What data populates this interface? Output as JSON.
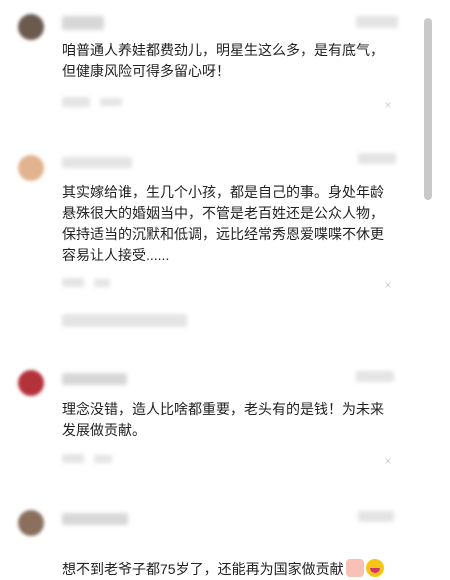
{
  "comments": [
    {
      "text": "咱普通人养娃都费劲儿，明星生这么多，是有底气，\n但健康风险可得多留心呀！",
      "avatar_color": "#6b5a4e"
    },
    {
      "text": "其实嫁给谁，生几个小孩，都是自己的事。身处年龄\n悬殊很大的婚姻当中，不管是老百姓还是公众人物，\n保持适当的沉默和低调，远比经常秀恩爱喋喋不休更\n容易让人接受......",
      "avatar_color": "#e2b38f"
    },
    {
      "text": "理念没错，造人比啥都重要，老头有的是钱！为未来\n发展做贡献。",
      "avatar_color": "#b4323a"
    },
    {
      "text": "想不到老爷子都75岁了，还能再为国家做贡献",
      "avatar_color": "#8a6f5e",
      "emojis": [
        "thumbs-up-icon",
        "smile-icon"
      ]
    }
  ],
  "close_glyph": "×",
  "colors": {
    "scrollbar": "#c9c9c9",
    "blur": "#d7d7d7"
  }
}
